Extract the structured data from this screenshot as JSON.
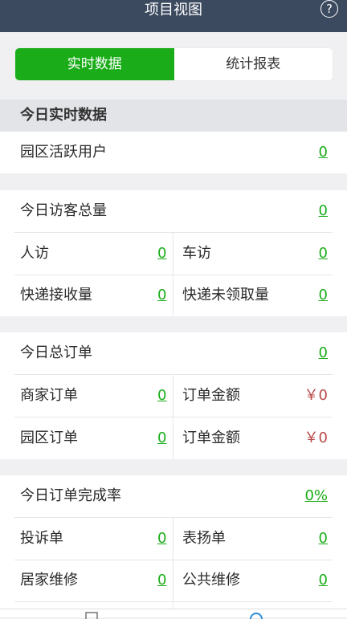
{
  "nav": {
    "title": "项目视图",
    "help_icon": "?"
  },
  "segments": {
    "realtime": "实时数据",
    "report": "统计报表"
  },
  "section": {
    "title": "今日实时数据"
  },
  "active_users": {
    "label": "园区活跃用户",
    "value": "0"
  },
  "visitors": {
    "label": "今日访客总量",
    "value": "0",
    "person_label": "人访",
    "person_value": "0",
    "car_label": "车访",
    "car_value": "0",
    "express_in_label": "快递接收量",
    "express_in_value": "0",
    "express_unclaimed_label": "快递未领取量",
    "express_unclaimed_value": "0"
  },
  "orders": {
    "label": "今日总订单",
    "value": "0",
    "merchant_label": "商家订单",
    "merchant_value": "0",
    "merchant_amount_label": "订单金额",
    "merchant_amount_value": "￥0",
    "park_label": "园区订单",
    "park_value": "0",
    "park_amount_label": "订单金额",
    "park_amount_value": "￥0"
  },
  "completion": {
    "label": "今日订单完成率",
    "value": "0%",
    "complaint_label": "投诉单",
    "complaint_value": "0",
    "praise_label": "表扬单",
    "praise_value": "0",
    "home_repair_label": "居家维修",
    "home_repair_value": "0",
    "public_repair_label": "公共维修",
    "public_repair_value": "0"
  },
  "colors": {
    "nav": "#3b4a5f",
    "accent": "#1aad19",
    "money": "#b94a48"
  }
}
